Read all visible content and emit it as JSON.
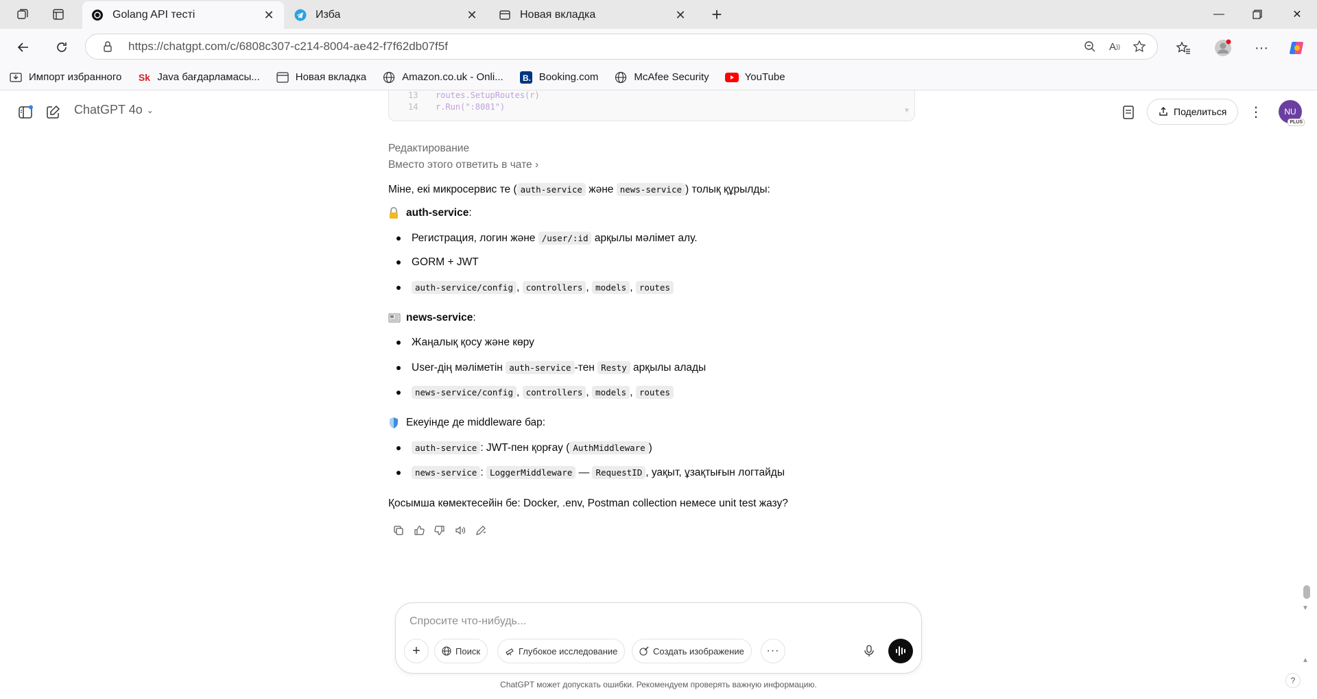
{
  "browser": {
    "tabs": [
      {
        "title": "Golang API тесті",
        "active": true
      },
      {
        "title": "Изба",
        "active": false
      },
      {
        "title": "Новая вкладка",
        "active": false
      }
    ],
    "url_host": "https://chatgpt.com",
    "url_path": "/c/6808c307-c214-8004-ae42-f7f62db07f5f",
    "favorites": [
      {
        "label": "Импорт избранного",
        "icon": "import-icon"
      },
      {
        "label": "Java бағдарламасы...",
        "icon": "sk-icon"
      },
      {
        "label": "Новая вкладка",
        "icon": "tab-icon"
      },
      {
        "label": "Amazon.co.uk - Onli...",
        "icon": "globe-icon"
      },
      {
        "label": "Booking.com",
        "icon": "booking-icon"
      },
      {
        "label": "McAfee Security",
        "icon": "globe-icon"
      },
      {
        "label": "YouTube",
        "icon": "youtube-icon"
      }
    ]
  },
  "app": {
    "model": "ChatGPT 4o",
    "share_label": "Поделиться",
    "avatar_initials": "NU",
    "avatar_badge": "PLUS"
  },
  "code_tail": [
    {
      "ln": "13",
      "code": "routes.SetupRoutes(r)"
    },
    {
      "ln": "14",
      "code": "r.Run(\":8081\")"
    }
  ],
  "message": {
    "edit_label": "Редактирование",
    "reply_link": "Вместо этого ответить в чате",
    "intro_pre": "Міне, екі микросервис те (",
    "intro_code1": "auth-service",
    "intro_mid": "және",
    "intro_code2": "news-service",
    "intro_post": ") толық құрылды:",
    "auth_heading": "auth-service",
    "auth_b1_pre": "Регистрация, логин және",
    "auth_b1_code": "/user/:id",
    "auth_b1_post": "арқылы мәлімет алу.",
    "auth_b2": "GORM + JWT",
    "auth_b3_codes": [
      "auth-service/config",
      "controllers",
      "models",
      "routes"
    ],
    "news_heading": "news-service",
    "news_b1": "Жаңалық қосу және көру",
    "news_b2_pre": "User-дің мәліметін",
    "news_b2_code1": "auth-service",
    "news_b2_mid": "-тен",
    "news_b2_code2": "Resty",
    "news_b2_post": "арқылы алады",
    "news_b3_codes": [
      "news-service/config",
      "controllers",
      "models",
      "routes"
    ],
    "mw_heading": "Екеуінде де middleware бар:",
    "mw_b1_code1": "auth-service",
    "mw_b1_text": ": JWT-пен қорғау (",
    "mw_b1_code2": "AuthMiddleware",
    "mw_b1_post": ")",
    "mw_b2_code1": "news-service",
    "mw_b2_code2": "LoggerMiddleware",
    "mw_b2_dash": "—",
    "mw_b2_code3": "RequestID",
    "mw_b2_post": ", уақыт, ұзақтығын логтайды",
    "closing": "Қосымша көмектесейін бе: Docker, .env, Postman collection немесе unit test жазу?"
  },
  "composer": {
    "placeholder": "Спросите что-нибудь...",
    "search": "Поиск",
    "deep_research": "Глубокое исследование",
    "create_image": "Создать изображение"
  },
  "disclaimer": "ChatGPT может допускать ошибки. Рекомендуем проверять важную информацию.",
  "help": "?"
}
